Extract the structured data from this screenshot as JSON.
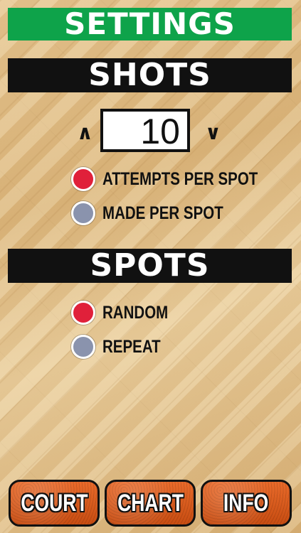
{
  "header": {
    "title": "SETTINGS"
  },
  "shots": {
    "heading": "SHOTS",
    "up_arrow": "∧",
    "down_arrow": "∨",
    "value": "10",
    "options": [
      {
        "label": "ATTEMPTS PER SPOT",
        "selected": true
      },
      {
        "label": "MADE PER SPOT",
        "selected": false
      }
    ]
  },
  "spots": {
    "heading": "SPOTS",
    "options": [
      {
        "label": "RANDOM",
        "selected": true
      },
      {
        "label": "REPEAT",
        "selected": false
      }
    ]
  },
  "footer": {
    "buttons": [
      {
        "label": "COURT"
      },
      {
        "label": "CHART"
      },
      {
        "label": "INFO"
      }
    ]
  },
  "colors": {
    "header_green": "#0ea34a",
    "bar_black": "#111111",
    "radio_selected": "#e0203a",
    "radio_unselected": "#8a93ad",
    "button_orange": "#d9591c"
  },
  "icons": [
    "caret-up-icon",
    "caret-down-icon"
  ]
}
